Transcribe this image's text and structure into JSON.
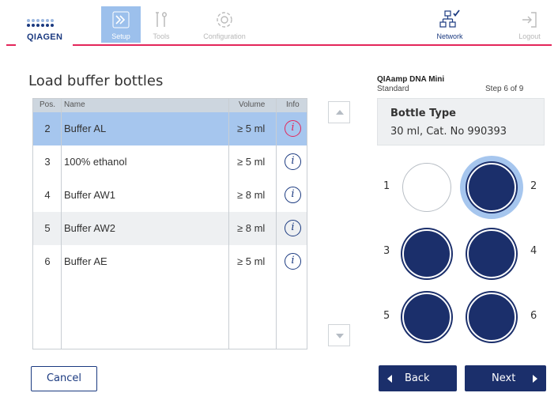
{
  "header": {
    "brand": "QIAGEN",
    "nav": [
      {
        "label": "Setup",
        "icon": "double-chevron-icon",
        "active": true
      },
      {
        "label": "Tools",
        "icon": "tools-icon",
        "active": false
      },
      {
        "label": "Configuration",
        "icon": "gear-icon",
        "active": false
      },
      {
        "label": "Network",
        "icon": "network-icon",
        "active": false
      },
      {
        "label": "Logout",
        "icon": "logout-icon",
        "active": false
      }
    ]
  },
  "page": {
    "title": "Load buffer bottles"
  },
  "table": {
    "columns": {
      "pos": "Pos.",
      "name": "Name",
      "volume": "Volume",
      "info": "Info"
    },
    "rows": [
      {
        "pos": "2",
        "name": "Buffer AL",
        "volume": "≥ 5 ml",
        "info_icon": "info-icon",
        "selected": true
      },
      {
        "pos": "3",
        "name": "100% ethanol",
        "volume": "≥ 5 ml",
        "info_icon": "info-icon",
        "selected": false
      },
      {
        "pos": "4",
        "name": "Buffer AW1",
        "volume": "≥ 8 ml",
        "info_icon": "info-icon",
        "selected": false
      },
      {
        "pos": "5",
        "name": "Buffer AW2",
        "volume": "≥ 8 ml",
        "info_icon": "info-icon",
        "selected": false
      },
      {
        "pos": "6",
        "name": "Buffer AE",
        "volume": "≥ 5 ml",
        "info_icon": "info-icon",
        "selected": false
      }
    ]
  },
  "protocol": {
    "kit": "QIAamp DNA Mini",
    "mode": "Standard",
    "step": "Step 6 of 9"
  },
  "bottle_type": {
    "title": "Bottle Type",
    "value": "30 ml, Cat. No 990393"
  },
  "bottles": [
    {
      "number": "1",
      "state": "empty"
    },
    {
      "number": "2",
      "state": "filled-selected"
    },
    {
      "number": "3",
      "state": "filled"
    },
    {
      "number": "4",
      "state": "filled"
    },
    {
      "number": "5",
      "state": "filled"
    },
    {
      "number": "6",
      "state": "filled"
    }
  ],
  "buttons": {
    "cancel": "Cancel",
    "back": "Back",
    "next": "Next"
  },
  "colors": {
    "accent_navy": "#1b2f6b",
    "brand_red": "#e3265a",
    "selected_row": "#a6c6ee",
    "active_nav": "#9cc0ec"
  }
}
